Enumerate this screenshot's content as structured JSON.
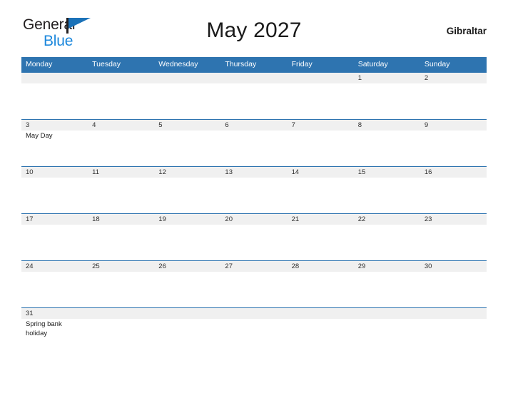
{
  "brand": {
    "name_part1": "General",
    "name_part2": "Blue",
    "flag_icon": "flag-icon",
    "color_primary": "#1b72b8",
    "color_secondary": "#1b87dc"
  },
  "header": {
    "title": "May 2027",
    "country": "Gibraltar"
  },
  "calendar": {
    "header_color": "#2e74b0",
    "band_color": "#f0f0f0",
    "weekdays": [
      "Monday",
      "Tuesday",
      "Wednesday",
      "Thursday",
      "Friday",
      "Saturday",
      "Sunday"
    ],
    "weeks": [
      [
        {
          "date": "",
          "events": []
        },
        {
          "date": "",
          "events": []
        },
        {
          "date": "",
          "events": []
        },
        {
          "date": "",
          "events": []
        },
        {
          "date": "",
          "events": []
        },
        {
          "date": "1",
          "events": []
        },
        {
          "date": "2",
          "events": []
        }
      ],
      [
        {
          "date": "3",
          "events": [
            "May Day"
          ]
        },
        {
          "date": "4",
          "events": []
        },
        {
          "date": "5",
          "events": []
        },
        {
          "date": "6",
          "events": []
        },
        {
          "date": "7",
          "events": []
        },
        {
          "date": "8",
          "events": []
        },
        {
          "date": "9",
          "events": []
        }
      ],
      [
        {
          "date": "10",
          "events": []
        },
        {
          "date": "11",
          "events": []
        },
        {
          "date": "12",
          "events": []
        },
        {
          "date": "13",
          "events": []
        },
        {
          "date": "14",
          "events": []
        },
        {
          "date": "15",
          "events": []
        },
        {
          "date": "16",
          "events": []
        }
      ],
      [
        {
          "date": "17",
          "events": []
        },
        {
          "date": "18",
          "events": []
        },
        {
          "date": "19",
          "events": []
        },
        {
          "date": "20",
          "events": []
        },
        {
          "date": "21",
          "events": []
        },
        {
          "date": "22",
          "events": []
        },
        {
          "date": "23",
          "events": []
        }
      ],
      [
        {
          "date": "24",
          "events": []
        },
        {
          "date": "25",
          "events": []
        },
        {
          "date": "26",
          "events": []
        },
        {
          "date": "27",
          "events": []
        },
        {
          "date": "28",
          "events": []
        },
        {
          "date": "29",
          "events": []
        },
        {
          "date": "30",
          "events": []
        }
      ],
      [
        {
          "date": "31",
          "events": [
            "Spring bank holiday"
          ]
        },
        {
          "date": "",
          "events": []
        },
        {
          "date": "",
          "events": []
        },
        {
          "date": "",
          "events": []
        },
        {
          "date": "",
          "events": []
        },
        {
          "date": "",
          "events": []
        },
        {
          "date": "",
          "events": []
        }
      ]
    ]
  }
}
